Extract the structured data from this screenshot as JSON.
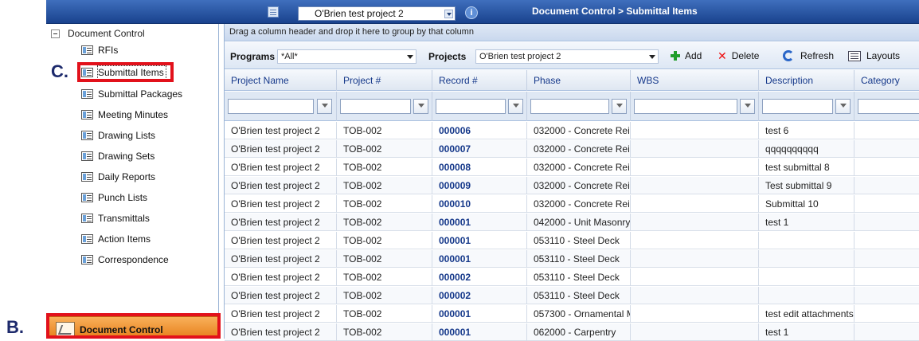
{
  "topbar": {
    "project": "O'Brien test project 2",
    "title": "Document Control > Submittal Items"
  },
  "nav": {
    "root": "Document Control",
    "items": [
      "RFIs",
      "Submittal Items",
      "Submittal Packages",
      "Meeting Minutes",
      "Drawing Lists",
      "Drawing Sets",
      "Daily Reports",
      "Punch Lists",
      "Transmittals",
      "Action Items",
      "Correspondence"
    ],
    "selected": "Submittal Items",
    "bottom_tab": "Document Control"
  },
  "callouts": {
    "b": "B.",
    "c": "C."
  },
  "main": {
    "group_hint": "Drag a column header and drop it here to group by that column",
    "toolbar": {
      "programs_label": "Programs",
      "programs_value": "*All*",
      "projects_label": "Projects",
      "projects_value": "O'Brien test project 2",
      "add": "Add",
      "delete": "Delete",
      "refresh": "Refresh",
      "layouts": "Layouts"
    },
    "columns": [
      "Project Name",
      "Project #",
      "Record #",
      "Phase",
      "WBS",
      "Description",
      "Category"
    ],
    "rows": [
      [
        "O'Brien test project 2",
        "TOB-002",
        "000006",
        "032000 - Concrete Rei",
        "",
        "test 6",
        ""
      ],
      [
        "O'Brien test project 2",
        "TOB-002",
        "000007",
        "032000 - Concrete Rei",
        "",
        "qqqqqqqqqq",
        ""
      ],
      [
        "O'Brien test project 2",
        "TOB-002",
        "000008",
        "032000 - Concrete Rei",
        "",
        "test submittal 8",
        ""
      ],
      [
        "O'Brien test project 2",
        "TOB-002",
        "000009",
        "032000 - Concrete Rei",
        "",
        "Test submittal 9",
        ""
      ],
      [
        "O'Brien test project 2",
        "TOB-002",
        "000010",
        "032000 - Concrete Rei",
        "",
        "Submittal 10",
        ""
      ],
      [
        "O'Brien test project 2",
        "TOB-002",
        "000001",
        "042000 - Unit Masonry",
        "",
        "test 1",
        ""
      ],
      [
        "O'Brien test project 2",
        "TOB-002",
        "000001",
        "053110 - Steel Deck",
        "",
        "",
        ""
      ],
      [
        "O'Brien test project 2",
        "TOB-002",
        "000001",
        "053110 - Steel Deck",
        "",
        "",
        ""
      ],
      [
        "O'Brien test project 2",
        "TOB-002",
        "000002",
        "053110 - Steel Deck",
        "",
        "",
        ""
      ],
      [
        "O'Brien test project 2",
        "TOB-002",
        "000002",
        "053110 - Steel Deck",
        "",
        "",
        ""
      ],
      [
        "O'Brien test project 2",
        "TOB-002",
        "000001",
        "057300 - Ornamental M",
        "",
        "test edit attachments",
        ""
      ],
      [
        "O'Brien test project 2",
        "TOB-002",
        "000001",
        "062000 - Carpentry",
        "",
        "test 1",
        ""
      ]
    ]
  },
  "colors": {
    "title_bar": "#19428d",
    "callout_red": "#e2111b",
    "accent_orange": "#e67e1a",
    "link_blue": "#15388a"
  }
}
